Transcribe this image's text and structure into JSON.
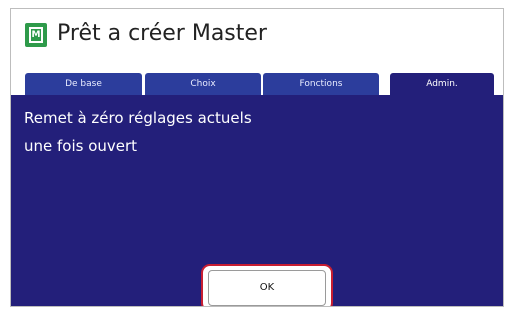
{
  "header": {
    "icon": "master-icon",
    "icon_letter": "M",
    "title": "Prêt a créer Master"
  },
  "tabs": [
    {
      "label": "De base",
      "active": false
    },
    {
      "label": "Choix",
      "active": false
    },
    {
      "label": "Fonctions",
      "active": false
    },
    {
      "label": "Admin.",
      "active": true
    }
  ],
  "panel": {
    "message_line1": "Remet à zéro réglages actuels",
    "message_line2": "une fois ouvert"
  },
  "actions": {
    "ok_label": "OK"
  },
  "colors": {
    "panel_background": "#231f7a",
    "tab_background": "#2c3d9c",
    "icon_green": "#2e9a4a",
    "highlight_red": "#c81e32"
  }
}
